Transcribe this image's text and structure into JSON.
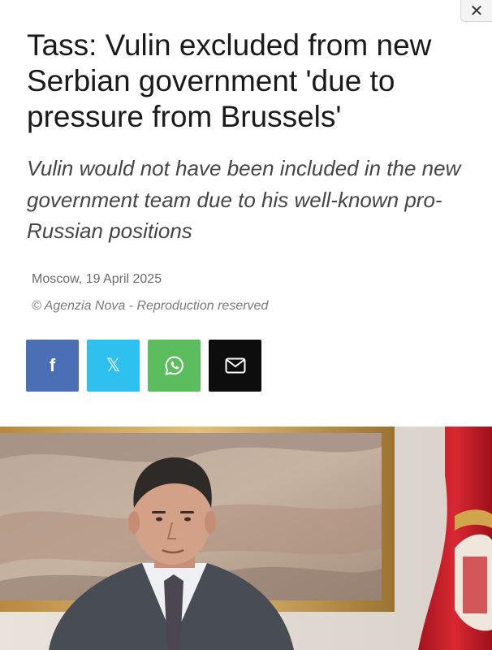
{
  "close_label": "✕",
  "article": {
    "title": "Tass: Vulin excluded from new Serbian government 'due to pressure from Brussels'",
    "subtitle": "Vulin would not have been included in the new government team due to his well-known pro-Russian positions",
    "dateline": "Moscow, 19 April 2025",
    "copyright": "© Agenzia Nova - Reproduction reserved"
  },
  "share": [
    {
      "name": "facebook",
      "glyph": "f",
      "color": "#4a6fb4"
    },
    {
      "name": "x",
      "glyph": "𝕏",
      "color": "#2ec0ee"
    },
    {
      "name": "whatsapp",
      "icon": "whatsapp-icon",
      "color": "#5cbd5e"
    },
    {
      "name": "email",
      "icon": "envelope-icon",
      "color": "#0d0d0d"
    }
  ],
  "colors": {
    "background": "#ffffff",
    "title": "#1a1a1a",
    "subtitle": "#454545",
    "meta": "#6a6a6a"
  }
}
